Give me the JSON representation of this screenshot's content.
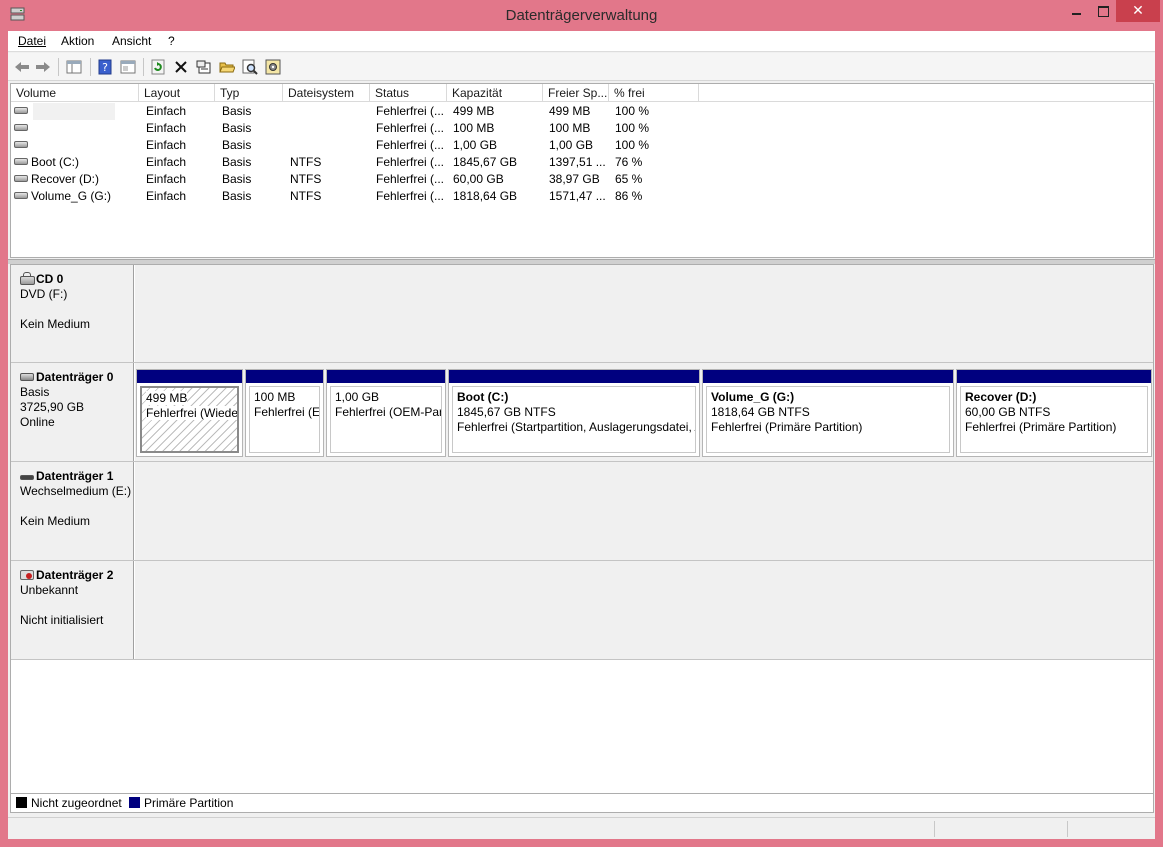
{
  "window": {
    "title": "Datenträgerverwaltung"
  },
  "menu": {
    "datei": "Datei",
    "aktion": "Aktion",
    "ansicht": "Ansicht",
    "help": "?"
  },
  "columns": [
    "Volume",
    "Layout",
    "Typ",
    "Dateisystem",
    "Status",
    "Kapazität",
    "Freier Sp...",
    "% frei"
  ],
  "volumes": [
    {
      "name": "",
      "layout": "Einfach",
      "typ": "Basis",
      "fs": "",
      "status": "Fehlerfrei (...",
      "kap": "499 MB",
      "frei": "499 MB",
      "pct": "100 %"
    },
    {
      "name": "",
      "layout": "Einfach",
      "typ": "Basis",
      "fs": "",
      "status": "Fehlerfrei (...",
      "kap": "100 MB",
      "frei": "100 MB",
      "pct": "100 %"
    },
    {
      "name": "",
      "layout": "Einfach",
      "typ": "Basis",
      "fs": "",
      "status": "Fehlerfrei (...",
      "kap": "1,00 GB",
      "frei": "1,00 GB",
      "pct": "100 %"
    },
    {
      "name": "Boot (C:)",
      "layout": "Einfach",
      "typ": "Basis",
      "fs": "NTFS",
      "status": "Fehlerfrei (...",
      "kap": "1845,67 GB",
      "frei": "1397,51 ...",
      "pct": "76 %"
    },
    {
      "name": "Recover (D:)",
      "layout": "Einfach",
      "typ": "Basis",
      "fs": "NTFS",
      "status": "Fehlerfrei (...",
      "kap": "60,00 GB",
      "frei": "38,97 GB",
      "pct": "65 %"
    },
    {
      "name": "Volume_G (G:)",
      "layout": "Einfach",
      "typ": "Basis",
      "fs": "NTFS",
      "status": "Fehlerfrei (...",
      "kap": "1818,64 GB",
      "frei": "1571,47 ...",
      "pct": "86 %"
    }
  ],
  "disks": {
    "cd0": {
      "name": "CD 0",
      "type": "DVD (F:)",
      "status": "Kein Medium"
    },
    "disk0": {
      "name": "Datenträger 0",
      "type": "Basis",
      "size": "3725,90 GB",
      "status": "Online",
      "partitions": [
        {
          "name": "",
          "size": "499 MB",
          "status": "Fehlerfrei (Wiederherstellungspartition)"
        },
        {
          "name": "",
          "size": "100 MB",
          "status": "Fehlerfrei (EFI-Systempartition)"
        },
        {
          "name": "",
          "size": "1,00 GB",
          "status": "Fehlerfrei (OEM-Partition)"
        },
        {
          "name": "Boot  (C:)",
          "size": "1845,67 GB NTFS",
          "status": "Fehlerfrei (Startpartition, Auslagerungsdatei, Absturzabbild, Primäre Partition)"
        },
        {
          "name": "Volume_G  (G:)",
          "size": "1818,64 GB NTFS",
          "status": "Fehlerfrei (Primäre Partition)"
        },
        {
          "name": "Recover  (D:)",
          "size": "60,00 GB NTFS",
          "status": "Fehlerfrei (Primäre Partition)"
        }
      ]
    },
    "disk1": {
      "name": "Datenträger 1",
      "type": "Wechselmedium (E:)",
      "status": "Kein Medium"
    },
    "disk2": {
      "name": "Datenträger 2",
      "type": "Unbekannt",
      "status": "Nicht initialisiert"
    }
  },
  "legend": {
    "unallocated": "Nicht zugeordnet",
    "primary": "Primäre Partition"
  },
  "colors": {
    "primary": "#00007f",
    "unallocated": "#000000",
    "frame": "#e2778a"
  }
}
